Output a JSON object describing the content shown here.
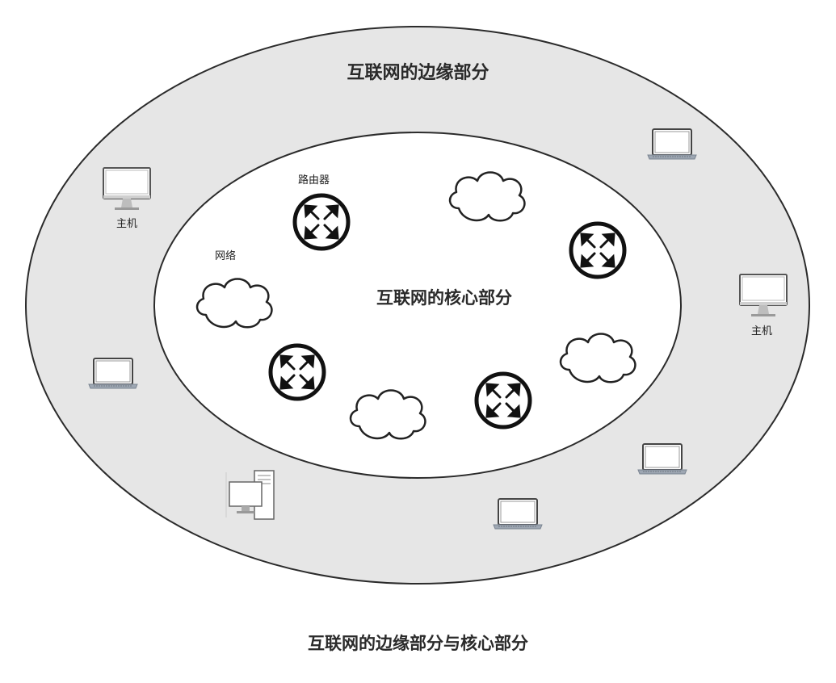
{
  "diagram": {
    "outer_label": "互联网的边缘部分",
    "inner_label": "互联网的核心部分",
    "caption": "互联网的边缘部分与核心部分",
    "router_label": "路由器",
    "network_label": "网络",
    "host_label_left": "主机",
    "host_label_right": "主机"
  },
  "colors": {
    "edge_fill": "#e6e6e6",
    "core_fill": "#ffffff",
    "stroke": "#2b2b2b"
  },
  "icons": {
    "router": "router-icon",
    "cloud": "cloud-icon",
    "monitor": "desktop-monitor-icon",
    "laptop": "laptop-icon",
    "pc": "desktop-pc-icon"
  }
}
